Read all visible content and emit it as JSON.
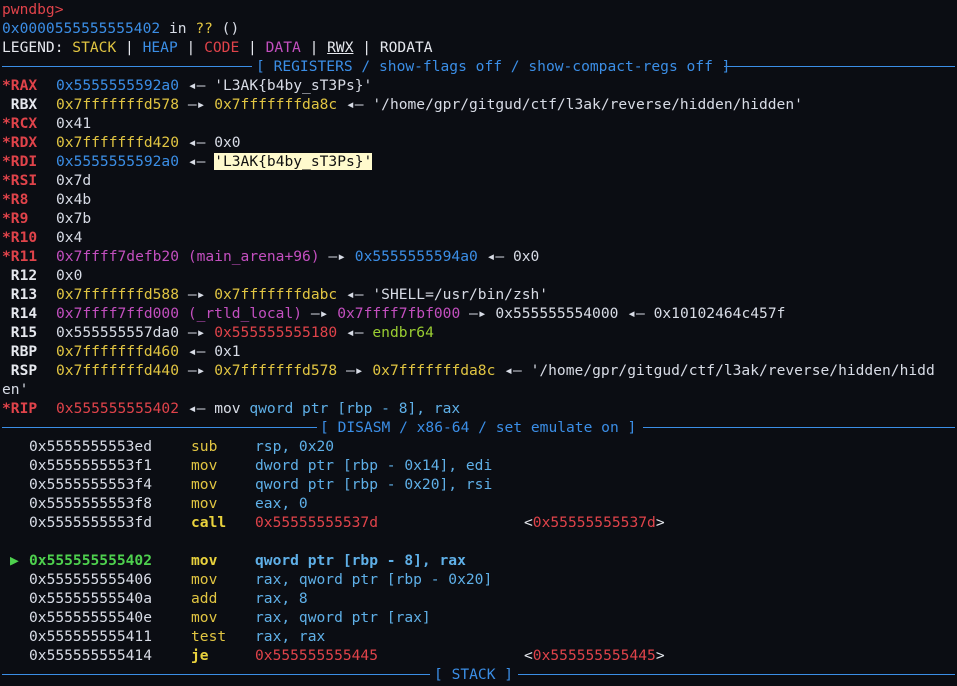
{
  "prompt": "pwndbg>",
  "location": {
    "addr": "0x0000555555555402",
    "in": " in ",
    "sym": "??",
    "args": " ()"
  },
  "legend": {
    "label": "LEGEND: ",
    "stack": "STACK",
    "heap": "HEAP",
    "code": "CODE",
    "data": "DATA",
    "rwx": "RWX",
    "rodata": "RODATA",
    "sep": " | "
  },
  "sections": {
    "registers": "[ REGISTERS / show-flags off / show-compact-regs off ]",
    "disasm": "[ DISASM / x86-64 / set emulate on ]",
    "stack": "[ STACK ]"
  },
  "arrows": {
    "points": "—▸",
    "ends": "◂—"
  },
  "registers": {
    "rax": {
      "star": "*",
      "name": "RAX",
      "v1": "0x5555555592a0",
      "v2": "'L3AK{b4by_sT3Ps}'"
    },
    "rbx": {
      "star": " ",
      "name": "RBX",
      "v1": "0x7fffffffd578",
      "v2": "0x7fffffffda8c",
      "v3": "'/home/gpr/gitgud/ctf/l3ak/reverse/hidden/hidden'"
    },
    "rcx": {
      "star": "*",
      "name": "RCX",
      "v1": "0x41"
    },
    "rdx": {
      "star": "*",
      "name": "RDX",
      "v1": "0x7fffffffd420",
      "v2": "0x0"
    },
    "rdi": {
      "star": "*",
      "name": "RDI",
      "v1": "0x5555555592a0",
      "v2": "'L3AK{b4by_sT3Ps}'"
    },
    "rsi": {
      "star": "*",
      "name": "RSI",
      "v1": "0x7d"
    },
    "r8": {
      "star": "*",
      "name": "R8",
      "v1": "0x4b"
    },
    "r9": {
      "star": "*",
      "name": "R9",
      "v1": "0x7b"
    },
    "r10": {
      "star": "*",
      "name": "R10",
      "v1": "0x4"
    },
    "r11": {
      "star": "*",
      "name": "R11",
      "v1": "0x7ffff7defb20",
      "sym": "(main_arena+96)",
      "v2": "0x5555555594a0",
      "v3": "0x0"
    },
    "r12": {
      "star": " ",
      "name": "R12",
      "v1": "0x0"
    },
    "r13": {
      "star": " ",
      "name": "R13",
      "v1": "0x7fffffffd588",
      "v2": "0x7fffffffdabc",
      "v3": "'SHELL=/usr/bin/zsh'"
    },
    "r14": {
      "star": " ",
      "name": "R14",
      "v1": "0x7ffff7ffd000",
      "sym": "(_rtld_local)",
      "v2": "0x7ffff7fbf000",
      "v3": "0x555555554000",
      "v4": "0x10102464c457f"
    },
    "r15": {
      "star": " ",
      "name": "R15",
      "v1": "0x555555557da0",
      "v2": "0x555555555180",
      "v3": "endbr64"
    },
    "rbp": {
      "star": " ",
      "name": "RBP",
      "v1": "0x7fffffffd460",
      "v2": "0x1"
    },
    "rsp": {
      "star": " ",
      "name": "RSP",
      "v1": "0x7fffffffd440",
      "v2": "0x7fffffffd578",
      "v3": "0x7fffffffda8c",
      "v4": "'/home/gpr/gitgud/ctf/l3ak/reverse/hidden/hidd",
      "wrap": "en'"
    },
    "rip": {
      "star": "*",
      "name": "RIP",
      "v1": "0x555555555402",
      "instr": "mov",
      "op1": "qword ptr [rbp - 8], rax"
    }
  },
  "disasm": [
    {
      "marker": "",
      "addr": "0x5555555553ed",
      "mn": "sub",
      "ops": "rsp, 0x20"
    },
    {
      "marker": "",
      "addr": "0x5555555553f1",
      "mn": "mov",
      "ops": "dword ptr [rbp - 0x14], edi"
    },
    {
      "marker": "",
      "addr": "0x5555555553f4",
      "mn": "mov",
      "ops": "qword ptr [rbp - 0x20], rsi"
    },
    {
      "marker": "",
      "addr": "0x5555555553f8",
      "mn": "mov",
      "ops": "eax, 0"
    },
    {
      "marker": "",
      "addr": "0x5555555553fd",
      "mn": "call",
      "ops": "0x55555555537d",
      "target": "<0x55555555537d>"
    },
    {
      "marker": "▶",
      "addr": "0x555555555402",
      "mn": "mov",
      "ops": "qword ptr [rbp - 8], rax"
    },
    {
      "marker": "",
      "addr": "0x555555555406",
      "mn": "mov",
      "ops": "rax, qword ptr [rbp - 0x20]"
    },
    {
      "marker": "",
      "addr": "0x55555555540a",
      "mn": "add",
      "ops": "rax, 8"
    },
    {
      "marker": "",
      "addr": "0x55555555540e",
      "mn": "mov",
      "ops": "rax, qword ptr [rax]"
    },
    {
      "marker": "",
      "addr": "0x555555555411",
      "mn": "test",
      "ops": "rax, rax"
    },
    {
      "marker": "",
      "addr": "0x555555555414",
      "mn": "je",
      "ops": "0x555555555445",
      "target": "<0x555555555445>"
    }
  ]
}
